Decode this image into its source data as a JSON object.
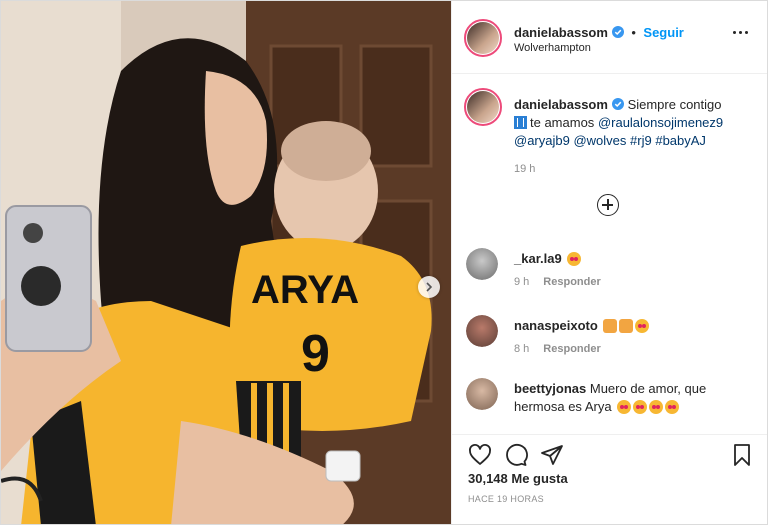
{
  "post": {
    "author": "danielabassom",
    "follow_label": "Seguir",
    "location": "Wolverhampton",
    "header_separator": "•"
  },
  "caption": {
    "author": "danielabassom",
    "text_1": "Siempre contigo",
    "text_2": "te amamos",
    "mentions": [
      "@raulalonsojimenez9",
      "@aryajb9",
      "@wolves",
      "#rj9",
      "#babyAJ"
    ],
    "time": "19 h"
  },
  "photo": {
    "jersey_name": "ARYA",
    "jersey_number": "9"
  },
  "comments": [
    {
      "author": "_kar.la9",
      "text": "",
      "emojis": [
        "heart-eyes-emoji"
      ],
      "time": "9 h",
      "reply_label": "Responder"
    },
    {
      "author": "nanaspeixoto",
      "text": "",
      "emojis": [
        "heart-eyes-cat-emoji",
        "heart-eyes-cat-emoji",
        "heart-eyes-emoji"
      ],
      "time": "8 h",
      "reply_label": "Responder"
    },
    {
      "author": "beettyjonas",
      "text": "Muero de amor, que hermosa es Arya",
      "emojis": [
        "heart-eyes-emoji",
        "heart-eyes-emoji",
        "heart-eyes-emoji",
        "heart-eyes-emoji"
      ]
    }
  ],
  "stats": {
    "likes": "30,148 Me gusta",
    "posted": "HACE 19 HORAS"
  },
  "colors": {
    "accent": "#0095f6",
    "verified": "#3897f0",
    "link": "#00376b",
    "muted": "#8e8e8e",
    "jersey": "#f6b52e"
  },
  "icons": {
    "like": "heart-icon",
    "comment": "comment-bubble-icon",
    "share": "paper-plane-icon",
    "save": "bookmark-icon",
    "more": "more-options-icon",
    "next": "chevron-right-icon",
    "load_more": "plus-circle-icon"
  }
}
